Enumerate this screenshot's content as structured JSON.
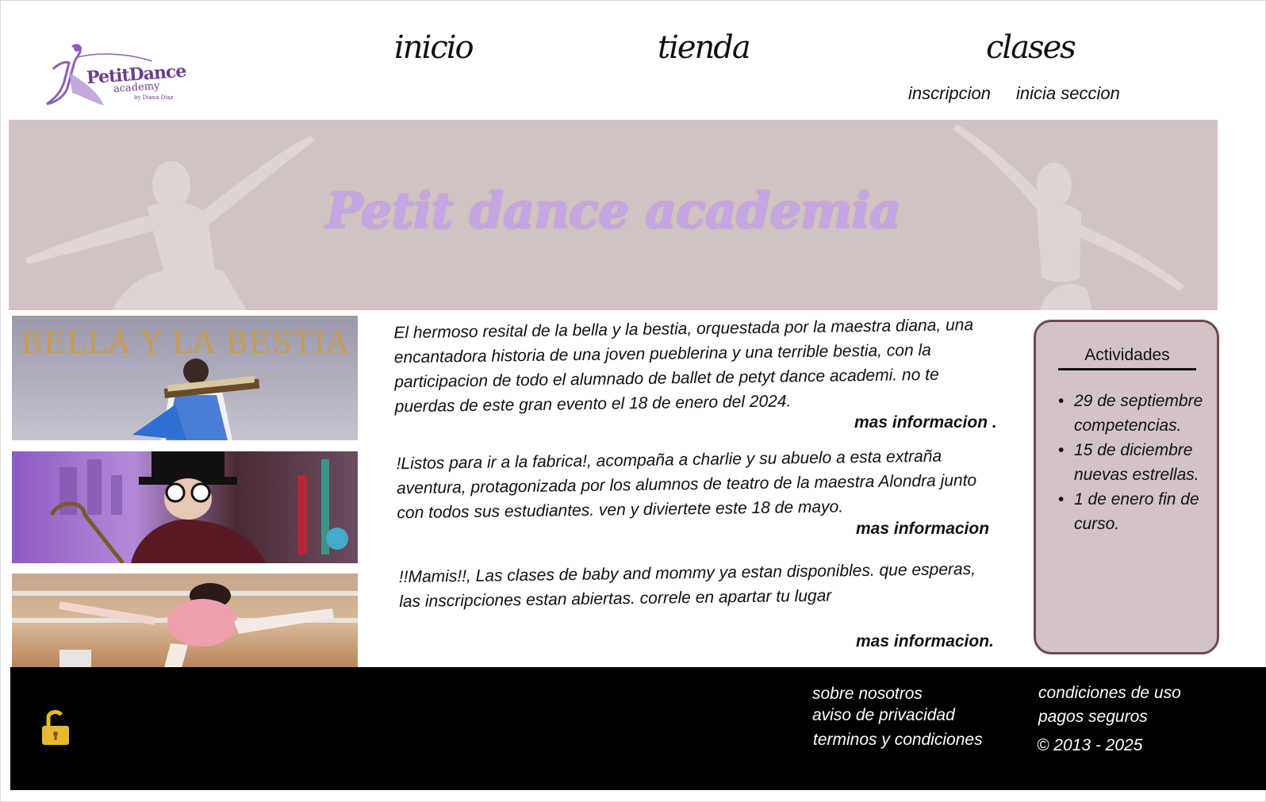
{
  "header": {
    "logo_text": "PetitDance",
    "logo_sub": "academy",
    "logo_tiny": "by Diana Díaz",
    "nav": [
      "inicio",
      "tienda",
      "clases"
    ],
    "sub_nav": [
      "inscripcion",
      "inicia seccion"
    ]
  },
  "banner": {
    "title": "Petit dance academia"
  },
  "images": {
    "first_title": "BELLA Y LA BESTIA"
  },
  "articles": [
    {
      "text": "El hermoso resital de la bella y la bestia, orquestada por la maestra diana, una encantadora historia de una joven pueblerina y una terrible bestia, con la participacion de todo el alumnado de ballet de petyt dance academi. no te puerdas de este gran evento el 18 de enero del 2024.",
      "more": "mas informacion ."
    },
    {
      "text": "!Listos para ir a la fabrica!, acompaña a charlie y su abuelo a esta extraña aventura, protagonizada por los alumnos de teatro de la maestra Alondra junto con todos sus estudiantes. ven y diviertete este 18 de mayo.",
      "more": "mas informacion"
    },
    {
      "text": "!!Mamis!!, Las clases de baby and mommy ya estan disponibles. que esperas, las inscripciones estan abiertas. correle en apartar tu lugar",
      "more": "mas informacion."
    }
  ],
  "activities": {
    "title": "Actividades",
    "items": [
      "29 de septiembre competencias.",
      "15 de diciembre nuevas estrellas.",
      "1 de enero fin de curso."
    ]
  },
  "footer": {
    "col1": [
      "sobre nosotros",
      "aviso de privacidad",
      "terminos y condiciones"
    ],
    "col2": [
      "condiciones de uso",
      "pagos seguros"
    ],
    "copyright": "© 2013 - 2025",
    "lock_icon": "lock-open-icon",
    "lock_color": "#e8b830"
  },
  "colors": {
    "banner_bg": "#d2c3c3",
    "banner_title": "#c7a6e6",
    "activities_bg": "#d3c3c6",
    "activities_border": "#6b4a4f",
    "footer_bg": "#000000",
    "logo": "#6b3f8f"
  }
}
